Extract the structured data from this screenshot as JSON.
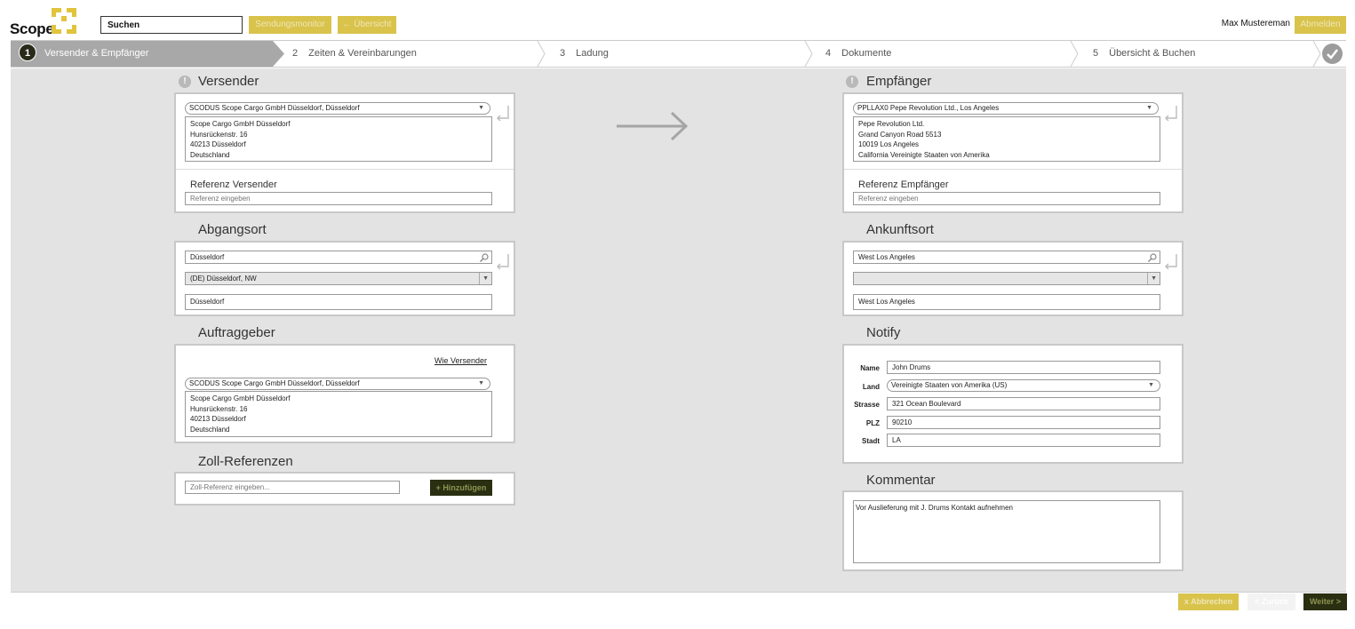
{
  "header": {
    "logo_text": "Scope",
    "search_value": "Suchen",
    "btn_monitor": "Sendungsmonitor",
    "btn_overview": "← Übersicht",
    "user_name": "Max Mustereman",
    "btn_logout": "Abmelden"
  },
  "steps": [
    {
      "num": "1",
      "label": "Versender & Empfänger"
    },
    {
      "num": "2",
      "label": "Zeiten & Vereinbarungen"
    },
    {
      "num": "3",
      "label": "Ladung"
    },
    {
      "num": "4",
      "label": "Dokumente"
    },
    {
      "num": "5",
      "label": "Übersicht & Buchen"
    }
  ],
  "sender": {
    "title": "Versender",
    "select": "SCODUS Scope Cargo GmbH Düsseldorf, Düsseldorf",
    "address": [
      "Scope Cargo GmbH Düsseldorf",
      "Hunsrückenstr. 16",
      "40213 Düsseldorf",
      "Deutschland"
    ],
    "ref_label": "Referenz Versender",
    "ref_placeholder": "Referenz eingeben"
  },
  "receiver": {
    "title": "Empfänger",
    "select": "PPLLAX0 Pepe Revolution Ltd., Los Angeles",
    "address": [
      "Pepe Revolution Ltd.",
      "Grand Canyon Road 5513",
      "10019 Los Angeles",
      "California Vereinigte Staaten von Amerika"
    ],
    "ref_label": "Referenz Empfänger",
    "ref_placeholder": "Referenz eingeben"
  },
  "origin": {
    "title": "Abgangsort",
    "search": "Düsseldorf",
    "select": "(DE) Düsseldorf, NW",
    "value": "Düsseldorf"
  },
  "destination": {
    "title": "Ankunftsort",
    "search": "West Los Angeles",
    "select": "",
    "value": "West Los Angeles"
  },
  "client": {
    "title": "Auftraggeber",
    "link": "Wie Versender",
    "select": "SCODUS Scope Cargo GmbH Düsseldorf, Düsseldorf",
    "address": [
      "Scope Cargo GmbH Düsseldorf",
      "Hunsrückenstr. 16",
      "40213 Düsseldorf",
      "Deutschland"
    ]
  },
  "customs": {
    "title": "Zoll-Referenzen",
    "placeholder": "Zoll-Referenz eingeben...",
    "add_btn": "+ Hinzufügen"
  },
  "notify": {
    "title": "Notify",
    "labels": {
      "name": "Name",
      "country": "Land",
      "street": "Strasse",
      "zip": "PLZ",
      "city": "Stadt"
    },
    "name": "John Drums",
    "country": "Vereinigte Staaten von Amerika (US)",
    "street": "321 Ocean Boulevard",
    "zip": "90210",
    "city": "LA"
  },
  "comment": {
    "title": "Kommentar",
    "text": "Vor Auslieferung mit J. Drums Kontakt aufnehmen"
  },
  "footer": {
    "cancel": "x Abbrechen",
    "back": "< Zurück",
    "next": "Weiter >"
  },
  "colors": {
    "accent": "#d9c34b",
    "dark": "#2a2f12",
    "background": "#e3e3e3"
  }
}
